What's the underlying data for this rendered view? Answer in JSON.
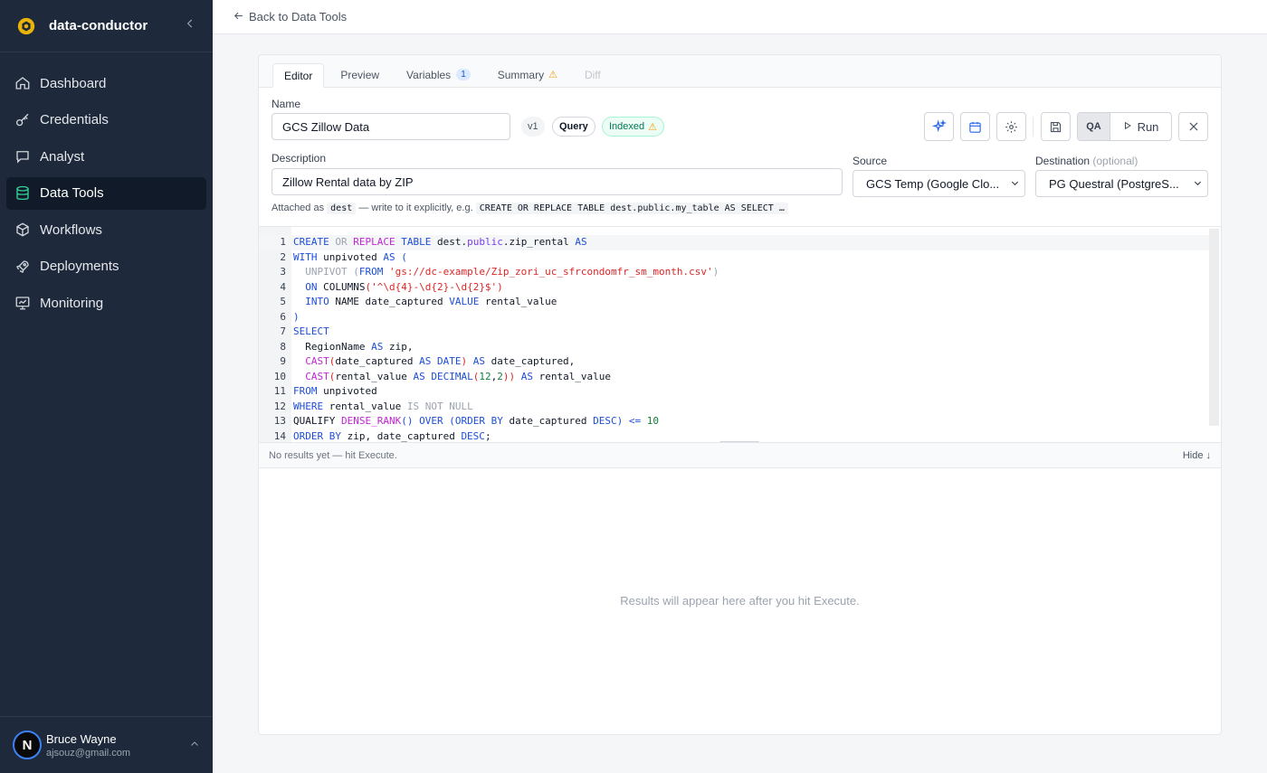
{
  "app": {
    "name": "data-conductor",
    "collapse_icon": "chevron-left-icon"
  },
  "sidebar": {
    "items": [
      {
        "label": "Dashboard",
        "icon": "home-icon"
      },
      {
        "label": "Credentials",
        "icon": "key-icon"
      },
      {
        "label": "Analyst",
        "icon": "chat-icon"
      },
      {
        "label": "Data Tools",
        "icon": "database-icon",
        "active": true
      },
      {
        "label": "Workflows",
        "icon": "cube-icon"
      },
      {
        "label": "Deployments",
        "icon": "rocket-icon"
      },
      {
        "label": "Monitoring",
        "icon": "monitor-icon"
      }
    ]
  },
  "user": {
    "initial": "N",
    "name": "Bruce Wayne",
    "email": "ajsouz@gmail.com"
  },
  "topbar": {
    "back_label": "Back to Data Tools"
  },
  "tabs": [
    {
      "label": "Editor",
      "active": true
    },
    {
      "label": "Preview"
    },
    {
      "label": "Variables",
      "badge": "1"
    },
    {
      "label": "Summary",
      "warning": "⚠"
    },
    {
      "label": "Diff",
      "disabled": true
    }
  ],
  "form": {
    "name_label": "Name",
    "name_value": "GCS Zillow Data",
    "version": "v1",
    "type_pill": "Query",
    "indexed_pill": "Indexed",
    "indexed_warning": "⚠",
    "description_label": "Description",
    "description_value": "Zillow Rental data by ZIP",
    "source_label": "Source",
    "source_value": "GCS Temp (Google Clo...",
    "destination_label": "Destination",
    "destination_optional": "(optional)",
    "destination_value": "PG Questral (PostgreS...",
    "attached_prefix": "Attached as",
    "attached_alias": "dest",
    "attached_middle": "— write to it explicitly, e.g.",
    "attached_example": "CREATE OR REPLACE TABLE dest.public.my_table AS SELECT …"
  },
  "toolbar": {
    "ai_icon": "sparkles-icon",
    "schedule_icon": "calendar-icon",
    "settings_icon": "gear-icon",
    "save_icon": "save-icon",
    "qa_label": "QA",
    "run_label": "Run",
    "close_icon": "close-icon"
  },
  "editor": {
    "lines": [
      {
        "n": "1",
        "tokens": [
          [
            "kw",
            "CREATE"
          ],
          [
            "t",
            " "
          ],
          [
            "gray",
            "OR"
          ],
          [
            "t",
            " "
          ],
          [
            "fn",
            "REPLACE"
          ],
          [
            "t",
            " "
          ],
          [
            "kw",
            "TABLE"
          ],
          [
            "t",
            " dest."
          ],
          [
            "kw2",
            "public"
          ],
          [
            "t",
            ".zip_rental "
          ],
          [
            "kw",
            "AS"
          ]
        ]
      },
      {
        "n": "2",
        "tokens": [
          [
            "kw",
            "WITH"
          ],
          [
            "t",
            " unpivoted "
          ],
          [
            "kw",
            "AS"
          ],
          [
            "t",
            " "
          ],
          [
            "kw",
            "("
          ]
        ]
      },
      {
        "n": "3",
        "tokens": [
          [
            "t",
            "  "
          ],
          [
            "gray",
            "UNPIVOT"
          ],
          [
            "t",
            " "
          ],
          [
            "gray",
            "("
          ],
          [
            "kw",
            "FROM"
          ],
          [
            "t",
            " "
          ],
          [
            "str",
            "'gs://dc-example/Zip_zori_uc_sfrcondomfr_sm_month.csv'"
          ],
          [
            "gray",
            ")"
          ]
        ]
      },
      {
        "n": "4",
        "tokens": [
          [
            "t",
            "  "
          ],
          [
            "kw",
            "ON"
          ],
          [
            "t",
            " COLUMNS"
          ],
          [
            "str",
            "('^\\d{4}-\\d{2}-\\d{2}$')"
          ]
        ]
      },
      {
        "n": "5",
        "tokens": [
          [
            "t",
            "  "
          ],
          [
            "kw",
            "INTO"
          ],
          [
            "t",
            " NAME date_captured "
          ],
          [
            "kw",
            "VALUE"
          ],
          [
            "t",
            " rental_value"
          ]
        ]
      },
      {
        "n": "6",
        "tokens": [
          [
            "kw",
            ")"
          ]
        ]
      },
      {
        "n": "7",
        "tokens": [
          [
            "kw",
            "SELECT"
          ]
        ]
      },
      {
        "n": "8",
        "tokens": [
          [
            "t",
            "  RegionName "
          ],
          [
            "kw",
            "AS"
          ],
          [
            "t",
            " zip,"
          ]
        ]
      },
      {
        "n": "9",
        "tokens": [
          [
            "t",
            "  "
          ],
          [
            "fn",
            "CAST"
          ],
          [
            "str",
            "("
          ],
          [
            "t",
            "date_captured "
          ],
          [
            "kw",
            "AS"
          ],
          [
            "t",
            " "
          ],
          [
            "kw",
            "DATE"
          ],
          [
            "str",
            ")"
          ],
          [
            "t",
            " "
          ],
          [
            "kw",
            "AS"
          ],
          [
            "t",
            " date_captured,"
          ]
        ]
      },
      {
        "n": "10",
        "tokens": [
          [
            "t",
            "  "
          ],
          [
            "fn",
            "CAST"
          ],
          [
            "str",
            "("
          ],
          [
            "t",
            "rental_value "
          ],
          [
            "kw",
            "AS"
          ],
          [
            "t",
            " "
          ],
          [
            "kw",
            "DECIMAL"
          ],
          [
            "str",
            "("
          ],
          [
            "num",
            "12"
          ],
          [
            "t",
            ","
          ],
          [
            "num",
            "2"
          ],
          [
            "str",
            "))"
          ],
          [
            "t",
            " "
          ],
          [
            "kw",
            "AS"
          ],
          [
            "t",
            " rental_value"
          ]
        ]
      },
      {
        "n": "11",
        "tokens": [
          [
            "kw",
            "FROM"
          ],
          [
            "t",
            " unpivoted"
          ]
        ]
      },
      {
        "n": "12",
        "tokens": [
          [
            "kw",
            "WHERE"
          ],
          [
            "t",
            " rental_value "
          ],
          [
            "gray",
            "IS NOT NULL"
          ]
        ]
      },
      {
        "n": "13",
        "tokens": [
          [
            "t",
            "QUALIFY "
          ],
          [
            "fn",
            "DENSE_RANK"
          ],
          [
            "kw",
            "()"
          ],
          [
            "t",
            " "
          ],
          [
            "kw",
            "OVER"
          ],
          [
            "t",
            " "
          ],
          [
            "kw",
            "("
          ],
          [
            "kw",
            "ORDER BY"
          ],
          [
            "t",
            " date_captured "
          ],
          [
            "kw",
            "DESC"
          ],
          [
            "kw",
            ")"
          ],
          [
            "t",
            " "
          ],
          [
            "kw",
            "<="
          ],
          [
            "t",
            " "
          ],
          [
            "num",
            "10"
          ]
        ]
      },
      {
        "n": "14",
        "tokens": [
          [
            "kw",
            "ORDER BY"
          ],
          [
            "t",
            " zip, date_captured "
          ],
          [
            "kw",
            "DESC"
          ],
          [
            "t",
            ";"
          ]
        ]
      }
    ]
  },
  "results": {
    "status": "No results yet — hit Execute.",
    "hide_label": "Hide ↓",
    "placeholder": "Results will appear here after you hit Execute."
  }
}
